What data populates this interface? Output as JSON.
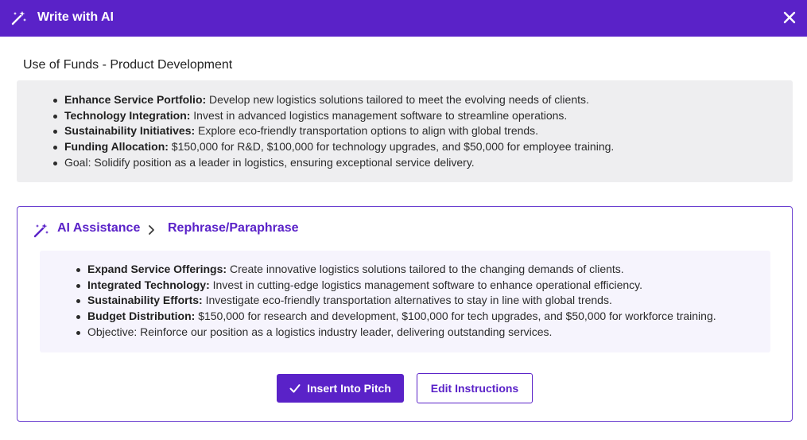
{
  "header": {
    "title": "Write with AI",
    "icon": "magic-wand-icon",
    "close_icon": "close-icon",
    "background": "#5a22c8"
  },
  "section": {
    "title": "Use of Funds - Product Development"
  },
  "original": {
    "items": [
      {
        "bold": "Enhance Service Portfolio:",
        "text": " Develop new logistics solutions tailored to meet the evolving needs of clients."
      },
      {
        "bold": "Technology Integration:",
        "text": " Invest in advanced logistics management software to streamline operations."
      },
      {
        "bold": "Sustainability Initiatives:",
        "text": " Explore eco-friendly transportation options to align with global trends."
      },
      {
        "bold": "Funding Allocation:",
        "text": " $150,000 for R&D, $100,000 for technology upgrades, and $50,000 for employee training."
      },
      {
        "bold": "",
        "text": "Goal: Solidify position as a leader in logistics, ensuring exceptional service delivery."
      }
    ]
  },
  "assistance": {
    "breadcrumb_root": "AI Assistance",
    "breadcrumb_current": "Rephrase/Paraphrase",
    "accent": "#5a22c8",
    "items": [
      {
        "bold": "Expand Service Offerings:",
        "text": " Create innovative logistics solutions tailored to the changing demands of clients."
      },
      {
        "bold": "Integrated Technology:",
        "text": " Invest in cutting-edge logistics management software to enhance operational efficiency."
      },
      {
        "bold": "Sustainability Efforts:",
        "text": " Investigate eco-friendly transportation alternatives to stay in line with global trends."
      },
      {
        "bold": "Budget Distribution:",
        "text": " $150,000 for research and development, $100,000 for tech upgrades, and $50,000 for workforce training."
      },
      {
        "bold": "",
        "text": "Objective: Reinforce our position as a logistics industry leader, delivering outstanding services."
      }
    ],
    "insert_label": "Insert Into Pitch",
    "edit_label": "Edit Instructions"
  }
}
